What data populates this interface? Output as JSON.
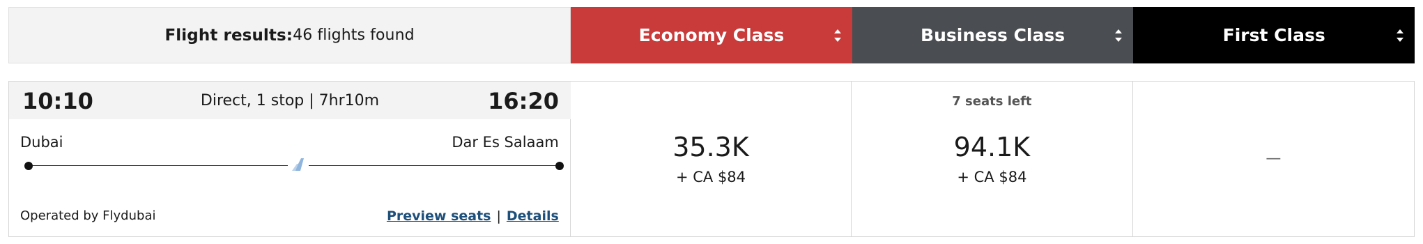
{
  "header": {
    "summary_label": "Flight results:",
    "summary_count": "46 flights found",
    "classes": [
      {
        "label": "Economy Class",
        "color": "#c83b3a"
      },
      {
        "label": "Business Class",
        "color": "#4a4d51"
      },
      {
        "label": "First Class",
        "color": "#000000"
      }
    ]
  },
  "flight": {
    "departure_time": "10:10",
    "arrival_time": "16:20",
    "duration": "Direct, 1 stop | 7hr10m",
    "origin": "Dubai",
    "destination": "Dar Es Salaam",
    "operator": "Operated by Flydubai",
    "preview_seats_label": "Preview seats",
    "separator": "|",
    "details_label": "Details",
    "plane_icon": "plane-tail-icon"
  },
  "fares": {
    "economy": {
      "points": "35.3K",
      "cash": "+ CA $84"
    },
    "business": {
      "seats_left": "7 seats left",
      "points": "94.1K",
      "cash": "+ CA $84"
    },
    "first": {
      "empty": "—"
    }
  },
  "colors": {
    "link": "#1d4f7a",
    "header_bg": "#f3f3f3",
    "plane_accent": "#8fb5dd"
  }
}
